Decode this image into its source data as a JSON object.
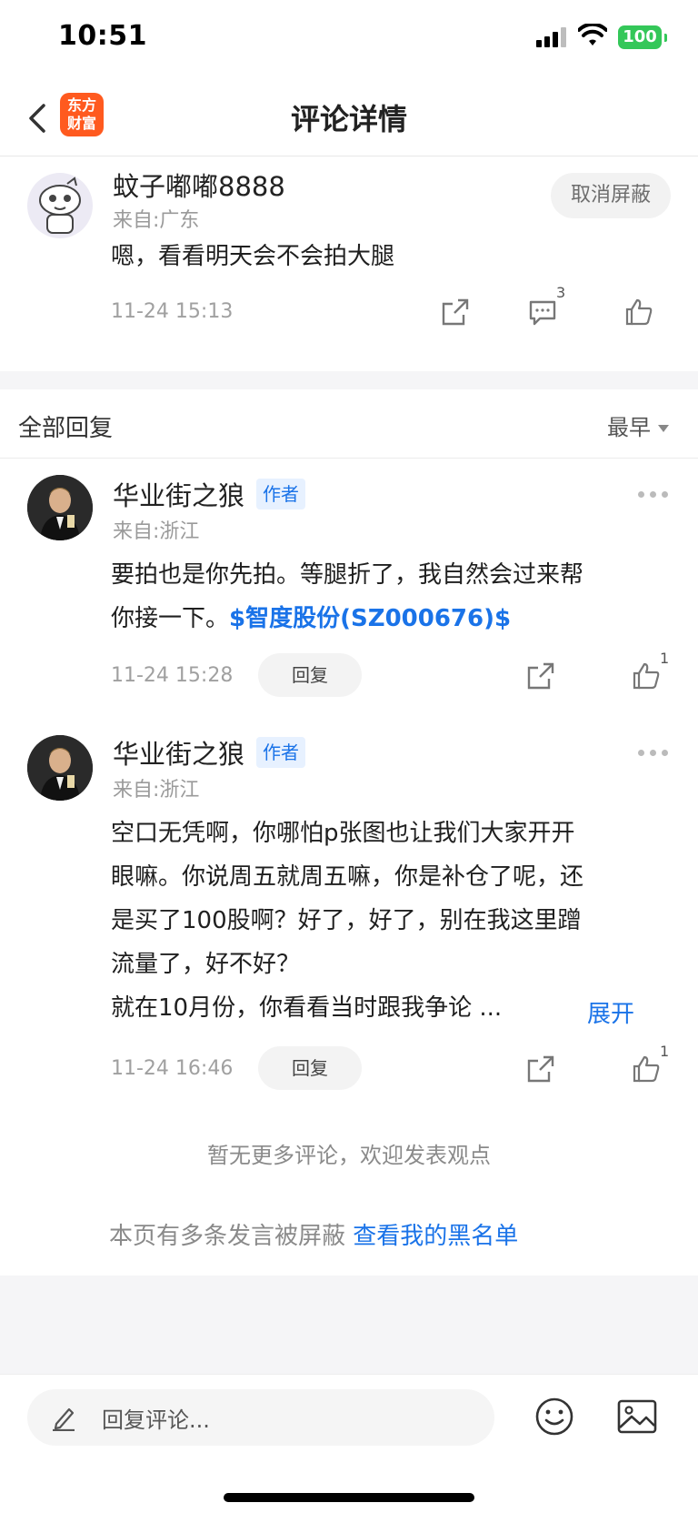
{
  "status_bar": {
    "time": "10:51",
    "battery": "100"
  },
  "nav": {
    "title": "评论详情",
    "logo_line1": "东方",
    "logo_line2": "财富"
  },
  "main_comment": {
    "username": "蚊子嘟嘟8888",
    "origin": "来自:广东",
    "unblock_label": "取消屏蔽",
    "text": "嗯，看看明天会不会拍大腿",
    "timestamp": "11-24 15:13",
    "comment_count": "3"
  },
  "replies": {
    "title": "全部回复",
    "sort_label": "最早",
    "items": [
      {
        "username": "华业街之狼",
        "badge": "作者",
        "origin": "来自:浙江",
        "text_line1": "要拍也是你先拍。等腿折了，我自然会过来帮",
        "text_line2_prefix": "你接一下。",
        "stock_link": "$智度股份(SZ000676)$",
        "timestamp": "11-24 15:28",
        "reply_label": "回复",
        "like_count": "1"
      },
      {
        "username": "华业街之狼",
        "badge": "作者",
        "origin": "来自:浙江",
        "text_lines": [
          "空口无凭啊，你哪怕p张图也让我们大家开开",
          "眼嘛。你说周五就周五嘛，你是补仓了呢，还",
          "是买了100股啊？好了，好了，别在我这里蹭",
          "流量了，好不好？",
          "就在10月份，你看看当时跟我争论 ..."
        ],
        "expand_label": "展开",
        "timestamp": "11-24 16:46",
        "reply_label": "回复",
        "like_count": "1"
      }
    ]
  },
  "footer": {
    "no_more": "暂无更多评论，欢迎发表观点",
    "blocked_note": "本页有多条发言被屏蔽",
    "blacklist_link": "查看我的黑名单"
  },
  "input_bar": {
    "placeholder": "回复评论..."
  }
}
